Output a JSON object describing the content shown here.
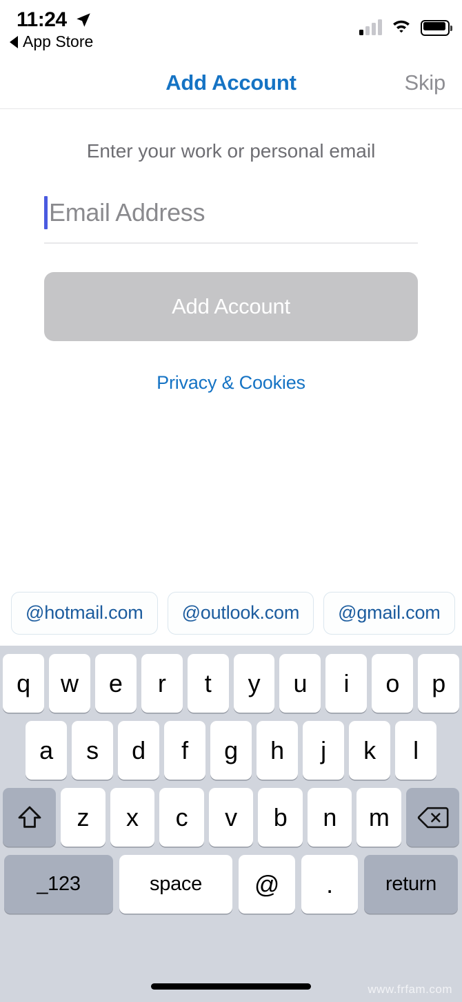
{
  "status_bar": {
    "time": "11:24",
    "location_icon": "location-arrow-icon",
    "back_label": "App Store",
    "back_icon": "back-triangle-icon",
    "signal_icon": "cellular-signal-icon",
    "signal_bars_filled": 1,
    "signal_bars_total": 4,
    "wifi_icon": "wifi-icon",
    "battery_icon": "battery-full-icon"
  },
  "nav_bar": {
    "title": "Add Account",
    "title_color": "#1573c4",
    "skip_label": "Skip",
    "skip_color": "#8e8e93"
  },
  "content": {
    "subtitle": "Enter your work or personal email",
    "email_input": {
      "placeholder": "Email Address",
      "value": "",
      "caret_color": "#4a5ae0"
    },
    "add_account_button": {
      "label": "Add Account",
      "background": "#c5c5c7",
      "text_color": "#ffffff",
      "enabled": false
    },
    "privacy_link": {
      "label": "Privacy & Cookies",
      "color": "#1573c4"
    }
  },
  "suggestion_bar": {
    "chips": [
      {
        "label": "@hotmail.com"
      },
      {
        "label": "@outlook.com"
      },
      {
        "label": "@gmail.com"
      }
    ],
    "chip_text_color": "#1c5c9e"
  },
  "keyboard": {
    "background": "#d1d5dd",
    "row1": [
      "q",
      "w",
      "e",
      "r",
      "t",
      "y",
      "u",
      "i",
      "o",
      "p"
    ],
    "row2": [
      "a",
      "s",
      "d",
      "f",
      "g",
      "h",
      "j",
      "k",
      "l"
    ],
    "row3_letters": [
      "z",
      "x",
      "c",
      "v",
      "b",
      "n",
      "m"
    ],
    "shift_icon": "shift-arrow-icon",
    "backspace_icon": "backspace-delete-icon",
    "row4": {
      "numbers_label": "_123",
      "space_label": "space",
      "at_label": "@",
      "dot_label": ".",
      "return_label": "return"
    }
  },
  "home_indicator": "home-indicator-bar",
  "watermark": "www.frfam.com"
}
